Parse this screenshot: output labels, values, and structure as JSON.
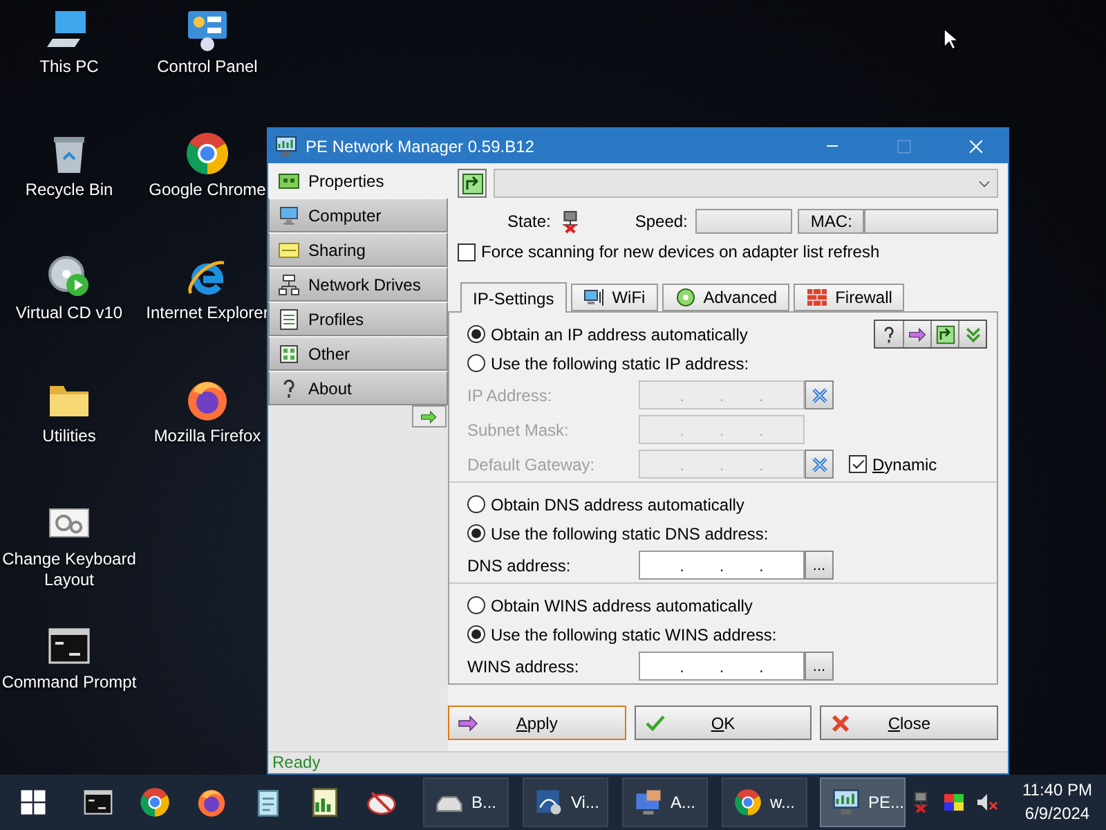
{
  "desktop_icons": [
    {
      "label": "This PC",
      "kind": "pc"
    },
    {
      "label": "Recycle Bin",
      "kind": "bin"
    },
    {
      "label": "Virtual CD v10",
      "kind": "vcd"
    },
    {
      "label": "Utilities",
      "kind": "folder"
    },
    {
      "label": "Change Keyboard Layout",
      "kind": "kbd"
    },
    {
      "label": "Command Prompt",
      "kind": "cmd"
    },
    {
      "label": "Control Panel",
      "kind": "cpanel"
    },
    {
      "label": "Google Chrome",
      "kind": "chrome"
    },
    {
      "label": "Internet Explorer",
      "kind": "ie"
    },
    {
      "label": "Mozilla Firefox",
      "kind": "firefox"
    }
  ],
  "window": {
    "title": "PE Network Manager 0.59.B12",
    "sidebar": [
      {
        "label": "Properties",
        "kind": "props",
        "selected": true
      },
      {
        "label": "Computer",
        "kind": "computer",
        "selected": false
      },
      {
        "label": "Sharing",
        "kind": "sharing",
        "selected": false
      },
      {
        "label": "Network Drives",
        "kind": "drives",
        "selected": false
      },
      {
        "label": "Profiles",
        "kind": "profiles",
        "selected": false
      },
      {
        "label": "Other",
        "kind": "other",
        "selected": false
      },
      {
        "label": "About",
        "kind": "about",
        "selected": false
      }
    ],
    "state_label": "State:",
    "speed_label": "Speed:",
    "mac_label": "MAC:",
    "force_scan": {
      "label": "Force scanning for new devices on adapter list refresh",
      "checked": false
    },
    "tabs": [
      {
        "label": "IP-Settings",
        "kind": "plain",
        "selected": true
      },
      {
        "label": "WiFi",
        "kind": "wifi",
        "selected": false
      },
      {
        "label": "Advanced",
        "kind": "advanced",
        "selected": false
      },
      {
        "label": "Firewall",
        "kind": "firewall",
        "selected": false
      }
    ],
    "ip_section": {
      "options": [
        {
          "label": "Obtain an IP address automatically",
          "selected": true
        },
        {
          "label": "Use the following static IP address:",
          "selected": false
        }
      ],
      "fields": [
        {
          "label": "IP Address:",
          "value": ". . .",
          "disabled": true,
          "kind": "clear"
        },
        {
          "label": "Subnet Mask:",
          "value": ". . .",
          "disabled": true,
          "kind": "plain"
        },
        {
          "label": "Default Gateway:",
          "value": ". . .",
          "disabled": true,
          "kind": "clear"
        }
      ],
      "dynamic": {
        "label": "Dynamic",
        "checked": true
      }
    },
    "dns_section": {
      "options": [
        {
          "label": "Obtain DNS address automatically",
          "selected": false
        },
        {
          "label": "Use the following static DNS address:",
          "selected": true
        }
      ],
      "field": {
        "label": "DNS address:",
        "value": ". . .",
        "disabled": false,
        "browse": "..."
      }
    },
    "wins_section": {
      "options": [
        {
          "label": "Obtain WINS address automatically",
          "selected": false
        },
        {
          "label": "Use the following static WINS address:",
          "selected": true
        }
      ],
      "field": {
        "label": "WINS address:",
        "value": ". . .",
        "disabled": false,
        "browse": "..."
      }
    },
    "buttons": [
      {
        "label": "Apply",
        "kind": "apply",
        "focused": true
      },
      {
        "label": "OK",
        "kind": "ok",
        "focused": false
      },
      {
        "label": "Close",
        "kind": "close",
        "focused": false
      }
    ],
    "status_bar": "Ready"
  },
  "taskbar": {
    "pinned": [
      {
        "kind": "cmd"
      },
      {
        "kind": "chrome"
      },
      {
        "kind": "firefox"
      },
      {
        "kind": "notepad"
      },
      {
        "kind": "chart"
      },
      {
        "kind": "paint"
      }
    ],
    "running": [
      {
        "label": "B...",
        "kind": "drive",
        "selected": false
      },
      {
        "label": "Vi...",
        "kind": "wizard",
        "selected": false
      },
      {
        "label": "A...",
        "kind": "deskapp",
        "selected": false
      },
      {
        "label": "w...",
        "kind": "chrome",
        "selected": false
      },
      {
        "label": "PE...",
        "kind": "netmgr",
        "selected": true
      }
    ],
    "tray": [
      {
        "kind": "netoff"
      },
      {
        "kind": "color"
      },
      {
        "kind": "mute"
      }
    ],
    "clock": {
      "time": "11:40 PM",
      "date": "6/9/2024"
    }
  }
}
